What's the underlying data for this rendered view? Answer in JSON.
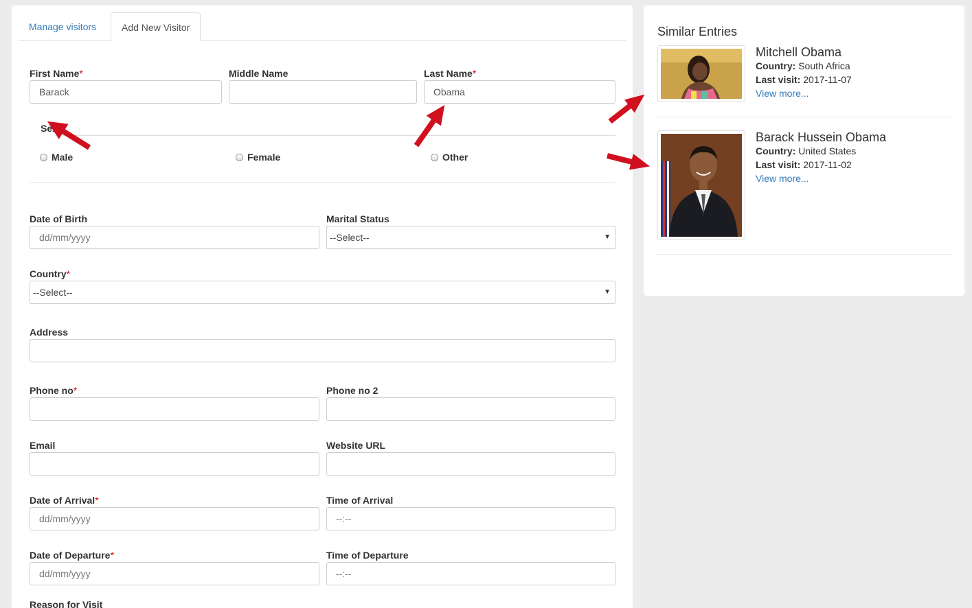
{
  "tabs": [
    {
      "label": "Manage visitors"
    },
    {
      "label": "Add New Visitor"
    }
  ],
  "form": {
    "first_name": {
      "label": "First Name",
      "value": "Barack"
    },
    "middle_name": {
      "label": "Middle Name",
      "value": ""
    },
    "last_name": {
      "label": "Last Name",
      "value": "Obama"
    },
    "sex": {
      "label": "Sex",
      "options": [
        "Male",
        "Female",
        "Other"
      ]
    },
    "dob": {
      "label": "Date of Birth",
      "placeholder": "dd/mm/yyyy"
    },
    "marital": {
      "label": "Marital Status",
      "selected": "--Select--"
    },
    "country": {
      "label": "Country",
      "selected": "--Select--"
    },
    "address": {
      "label": "Address"
    },
    "phone1": {
      "label": "Phone no"
    },
    "phone2": {
      "label": "Phone no 2"
    },
    "email": {
      "label": "Email"
    },
    "website": {
      "label": "Website URL"
    },
    "arrival_date": {
      "label": "Date of Arrival",
      "placeholder": "dd/mm/yyyy"
    },
    "arrival_time": {
      "label": "Time of Arrival",
      "placeholder": "--:--"
    },
    "departure_date": {
      "label": "Date of Departure",
      "placeholder": "dd/mm/yyyy"
    },
    "departure_time": {
      "label": "Time of Departure",
      "placeholder": "--:--"
    },
    "reason": {
      "label": "Reason for Visit"
    },
    "required_mark": "*"
  },
  "similar": {
    "title": "Similar Entries",
    "country_label": "Country:",
    "last_visit_label": "Last visit:",
    "entries": [
      {
        "name": "Mitchell Obama",
        "country": "South Africa",
        "last_visit": "2017-11-07",
        "link": "View more..."
      },
      {
        "name": "Barack Hussein Obama",
        "country": "United States",
        "last_visit": "2017-11-02",
        "link": "View more..."
      }
    ]
  },
  "colors": {
    "accent": "#337ab7",
    "required": "#cc0000",
    "arrow": "#d0101e",
    "page_bg": "#ececec"
  }
}
